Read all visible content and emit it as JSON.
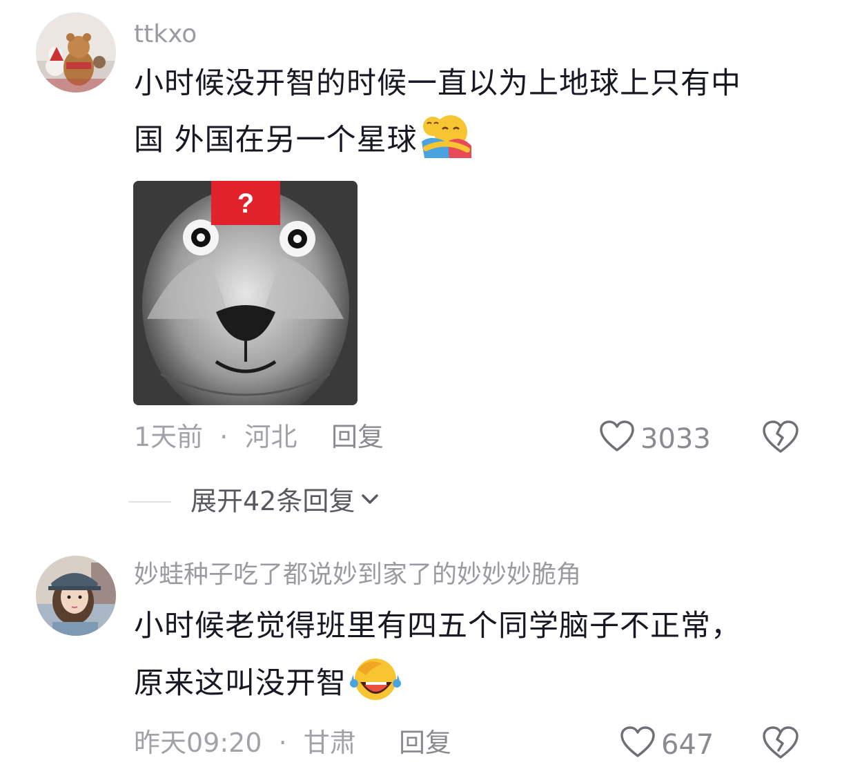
{
  "comments": [
    {
      "username": "ttkxo",
      "text_line1": "小时候没开智的时候一直以为上地球上只有中",
      "text_line2": "国 外国在另一个星球",
      "emoji": "hugging-face-emoji",
      "image": {
        "badge": "?"
      },
      "time": "1天前",
      "separator": "·",
      "location": "河北",
      "reply_label": "回复",
      "likes": "3033"
    },
    {
      "username": "妙蛙种子吃了都说妙到家了的妙妙妙脆角",
      "text_line1": "小时候老觉得班里有四五个同学脑子不正常，",
      "text_line2": "原来这叫没开智",
      "emoji": "rofl-emoji",
      "time": "昨天09:20",
      "separator": "·",
      "location": "甘肃",
      "reply_label": "回复",
      "likes": "647"
    }
  ],
  "expand_replies": {
    "label": "展开42条回复"
  },
  "icons": {
    "like": "heart-outline-icon",
    "dislike": "broken-heart-icon",
    "expand": "chevron-down-icon"
  }
}
